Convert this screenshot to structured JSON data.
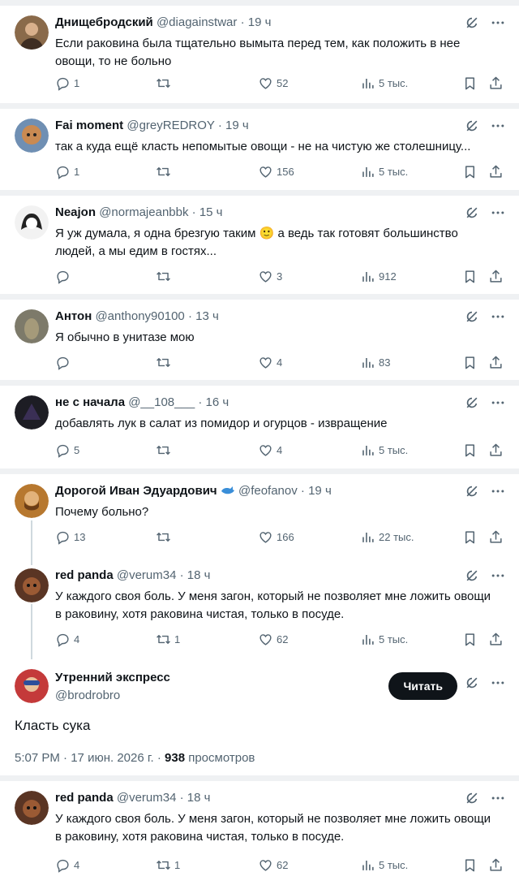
{
  "replies": [
    {
      "name": "Днищебродский",
      "handle": "@diagainstwar",
      "dot": "·",
      "time": "19 ч",
      "text": "Если раковина была тщательно вымыта перед тем, как положить в нее овощи, то не больно",
      "reply": "1",
      "retweet": "",
      "like": "52",
      "views": "5 тыс.",
      "avatar_color": "#8a6a4a"
    },
    {
      "name": "Fai moment",
      "handle": "@greyREDROY",
      "dot": "·",
      "time": "19 ч",
      "text": "так а куда ещё класть непомытые овощи - не на чистую же столешницу...",
      "reply": "1",
      "retweet": "",
      "like": "156",
      "views": "5 тыс.",
      "avatar_color": "#c98a52"
    },
    {
      "name": "Neajon",
      "handle": "@normajeanbbk",
      "dot": "·",
      "time": "15 ч",
      "text_a": "Я уж думала, я одна брезгую таким",
      "emoji": "🙂",
      "text_b": "а ведь так готовят большинство людей, а мы едим в гостях...",
      "reply": "",
      "retweet": "",
      "like": "3",
      "views": "912",
      "avatar_color": "#444444"
    },
    {
      "name": "Антон",
      "handle": "@anthony90100",
      "dot": "·",
      "time": "13 ч",
      "text": "Я обычно в унитазе мою",
      "reply": "",
      "retweet": "",
      "like": "4",
      "views": "83",
      "avatar_color": "#7d7a6a"
    },
    {
      "name": "не с начала",
      "handle": "@__108___",
      "dot": "·",
      "time": "16 ч",
      "text": "добавлять лук в салат из помидор и огурцов - извращение",
      "reply": "5",
      "retweet": "",
      "like": "4",
      "views": "5 тыс.",
      "avatar_color": "#1d1d24"
    },
    {
      "name": "Дорогой Иван Эдуардович",
      "handle": "@feofanov",
      "dot": "·",
      "time": "19 ч",
      "text": "Почему больно?",
      "reply": "13",
      "retweet": "",
      "like": "166",
      "views": "22 тыс.",
      "avatar_color": "#b7782f"
    },
    {
      "name": "red panda",
      "handle": "@verum34",
      "dot": "·",
      "time": "18 ч",
      "text": "У каждого своя боль. У меня загон, который не позволяет мне ложить овощи в раковину, хотя раковина чистая, только в посуде.",
      "reply": "4",
      "retweet": "1",
      "like": "62",
      "views": "5 тыс.",
      "avatar_color": "#5a3524"
    }
  ],
  "main": {
    "name": "Утренний экспресс",
    "handle": "@brodrobro",
    "follow_label": "Читать",
    "text": "Класть сука",
    "time": "5:07 PM",
    "date": "17 июн. 2026 г.",
    "views": "938",
    "views_label": "просмотров",
    "avatar_color": "#c43a3a"
  },
  "last": {
    "name": "red panda",
    "handle": "@verum34",
    "dot": "·",
    "time": "18 ч",
    "text": "У каждого своя боль. У меня загон, который не позволяет мне ложить овощи в раковину, хотя раковина чистая, только в посуде.",
    "reply": "4",
    "retweet": "1",
    "like": "62",
    "views": "5 тыс.",
    "avatar_color": "#5a3524"
  },
  "icons": [
    "comment-icon",
    "retweet-icon",
    "like-icon",
    "views-icon",
    "bookmark-icon",
    "share-icon",
    "grok-icon",
    "more-icon",
    "verified-icon"
  ]
}
